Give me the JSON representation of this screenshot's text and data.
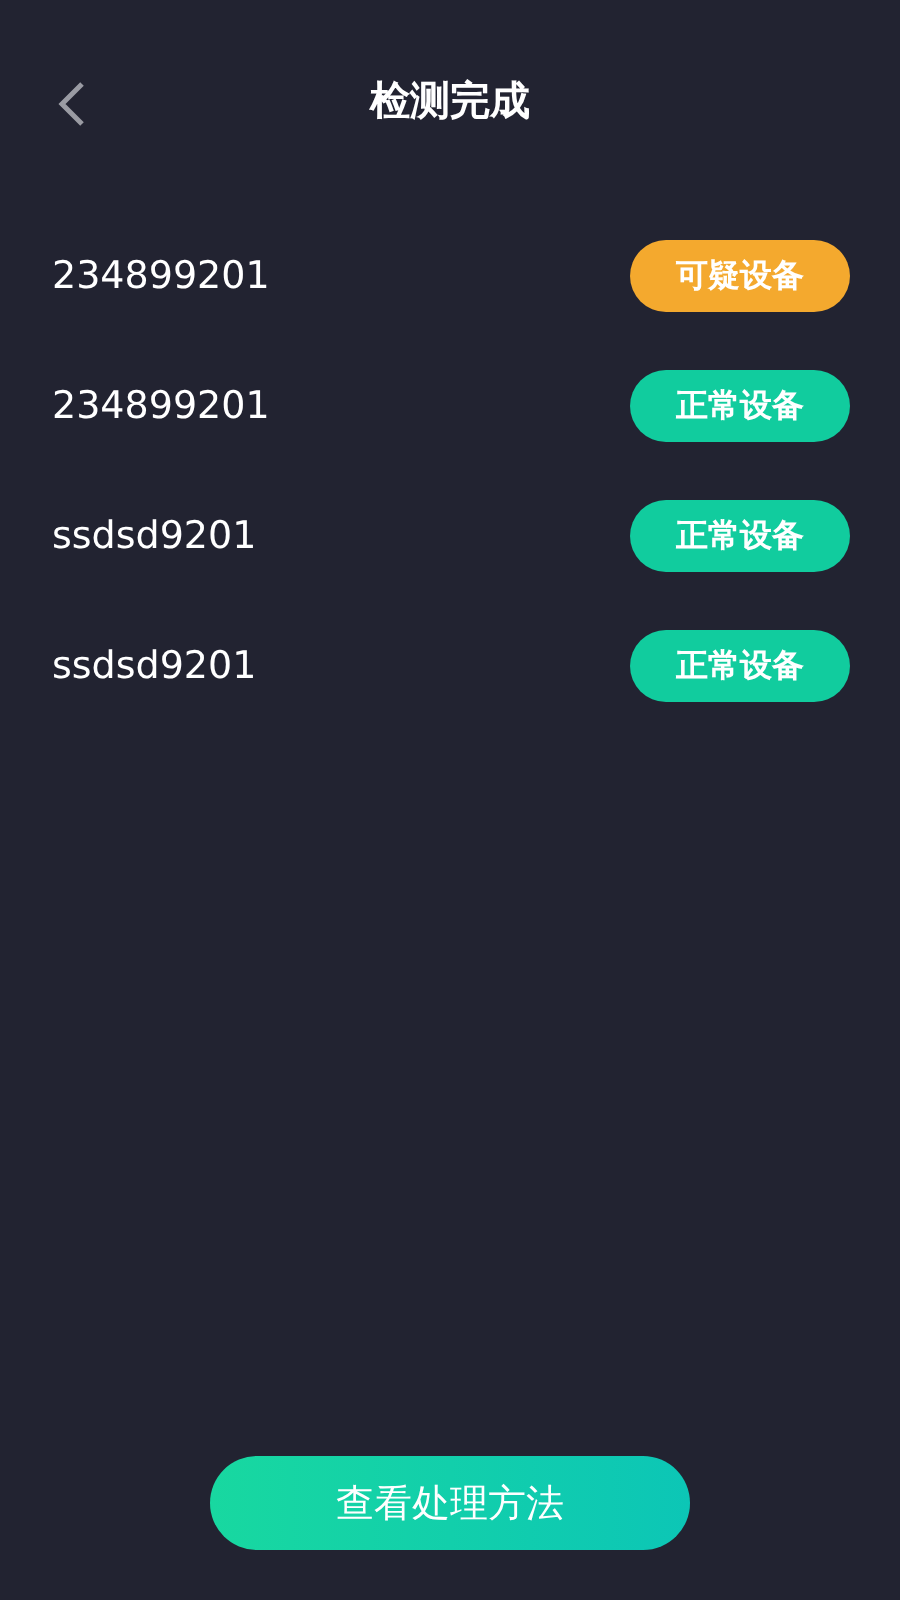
{
  "header": {
    "title": "检测完成"
  },
  "devices": [
    {
      "name": "234899201",
      "status": {
        "kind": "suspicious",
        "label": "可疑设备"
      }
    },
    {
      "name": "234899201",
      "status": {
        "kind": "normal",
        "label": "正常设备"
      }
    },
    {
      "name": "ssdsd9201",
      "status": {
        "kind": "normal",
        "label": "正常设备"
      }
    },
    {
      "name": "ssdsd9201",
      "status": {
        "kind": "normal",
        "label": "正常设备"
      }
    }
  ],
  "action_button": {
    "label": "查看处理方法"
  }
}
